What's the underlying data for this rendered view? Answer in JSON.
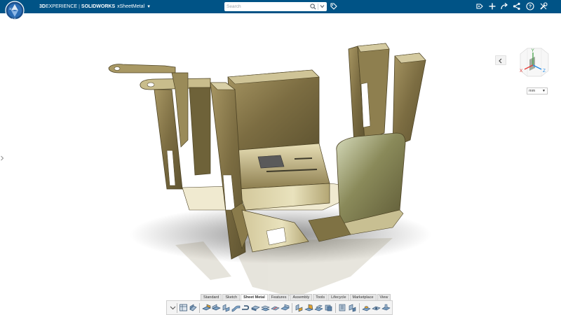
{
  "header": {
    "brand_3d": "3D",
    "brand_experience": "EXPERIENCE",
    "brand_solidworks": "SOLIDWORKS",
    "app_name": "xSheetMetal",
    "compass_label": "3D",
    "compass_version": "V.R",
    "search_placeholder": "Search",
    "accent": "#005386",
    "icons": [
      "tag-icon",
      "user-icon",
      "add-icon",
      "share-icon",
      "network-icon",
      "help-icon",
      "tools-icon"
    ]
  },
  "viewport": {
    "units_value": "mm",
    "view_axes": {
      "x": "X",
      "y": "Y",
      "z": "Z"
    },
    "axis_colors": {
      "x": "#e53935",
      "y": "#43a047",
      "z": "#1e88e5"
    },
    "model_color": "#8a7a4c"
  },
  "ribbon": {
    "tabs": [
      {
        "label": "Standard"
      },
      {
        "label": "Sketch"
      },
      {
        "label": "Sheet Metal",
        "active": true
      },
      {
        "label": "Features"
      },
      {
        "label": "Assembly"
      },
      {
        "label": "Tools"
      },
      {
        "label": "Lifecycle"
      },
      {
        "label": "Marketplace"
      },
      {
        "label": "View"
      }
    ],
    "tools": [
      "collapse-arrow-icon",
      "table-icon",
      "sheet-metal-icon",
      "flange-icon",
      "base-flange-icon",
      "edge-flange-icon",
      "sketched-bend-icon",
      "hem-icon",
      "miter-flange-icon",
      "jog-icon",
      "cross-break-icon",
      "corner-icon",
      "unfold-icon",
      "fold-icon",
      "flatten-icon",
      "convert-icon",
      "rip-icon",
      "lofted-bend-icon",
      "form-tool-icon",
      "vent-icon",
      "tab-icon"
    ]
  }
}
